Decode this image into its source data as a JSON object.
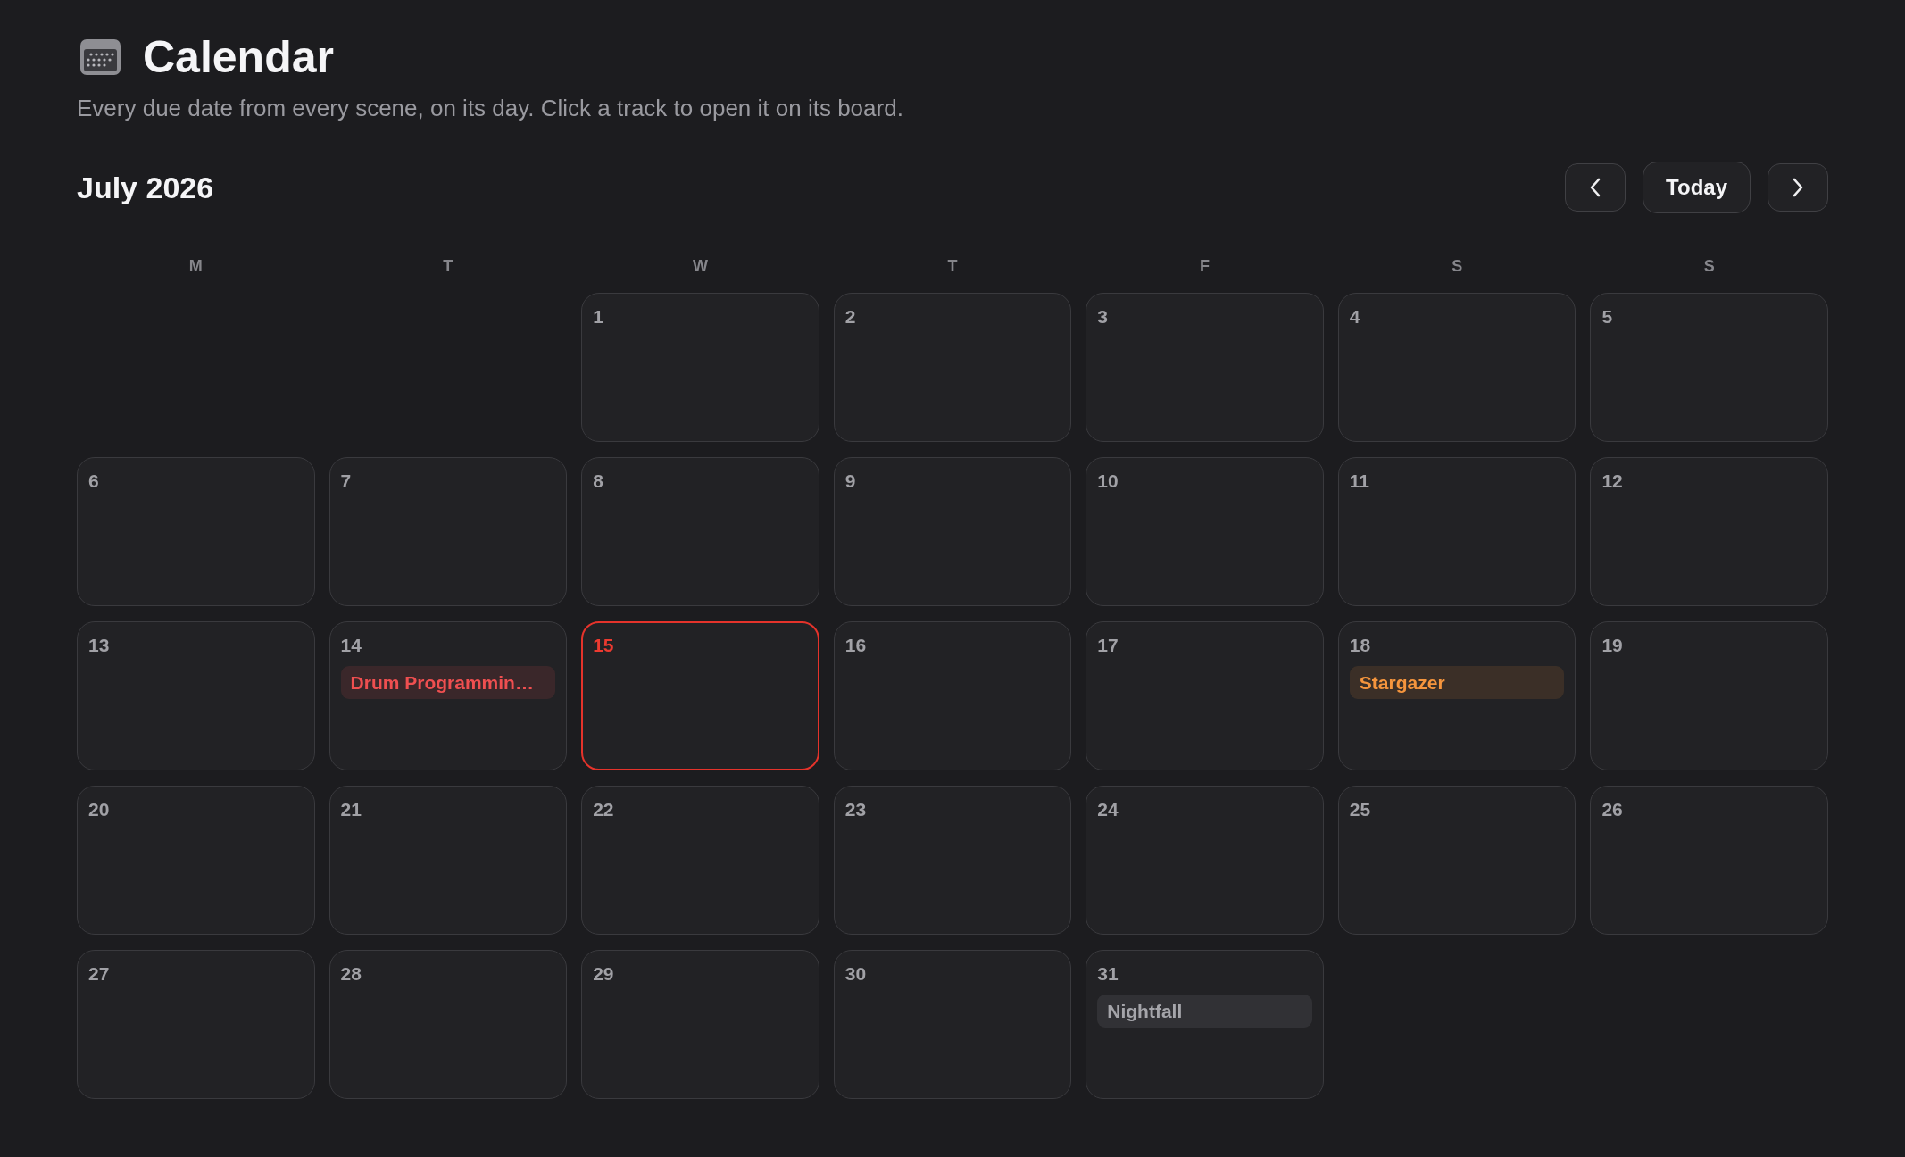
{
  "header": {
    "title": "Calendar",
    "subtitle": "Every due date from every scene, on its day. Click a track to open it on its board."
  },
  "month": {
    "label": "July 2026",
    "today_button": "Today"
  },
  "weekdays": [
    "M",
    "T",
    "W",
    "T",
    "F",
    "S",
    "S"
  ],
  "weeks": [
    {
      "days": [
        {
          "kind": "blank"
        },
        {
          "kind": "blank"
        },
        {
          "kind": "day",
          "number": "1",
          "today": false
        },
        {
          "kind": "day",
          "number": "2",
          "today": false
        },
        {
          "kind": "day",
          "number": "3",
          "today": false
        },
        {
          "kind": "day",
          "number": "4",
          "today": false
        },
        {
          "kind": "day",
          "number": "5",
          "today": false
        }
      ]
    },
    {
      "days": [
        {
          "kind": "day",
          "number": "6",
          "today": false
        },
        {
          "kind": "day",
          "number": "7",
          "today": false
        },
        {
          "kind": "day",
          "number": "8",
          "today": false
        },
        {
          "kind": "day",
          "number": "9",
          "today": false
        },
        {
          "kind": "day",
          "number": "10",
          "today": false
        },
        {
          "kind": "day",
          "number": "11",
          "today": false
        },
        {
          "kind": "day",
          "number": "12",
          "today": false
        }
      ]
    },
    {
      "days": [
        {
          "kind": "day",
          "number": "13",
          "today": false
        },
        {
          "kind": "day",
          "number": "14",
          "today": false,
          "events": [
            {
              "title": "Drum Programmin…",
              "color": "#ef4f50"
            }
          ]
        },
        {
          "kind": "day",
          "number": "15",
          "today": true
        },
        {
          "kind": "day",
          "number": "16",
          "today": false
        },
        {
          "kind": "day",
          "number": "17",
          "today": false
        },
        {
          "kind": "day",
          "number": "18",
          "today": false,
          "events": [
            {
              "title": "Stargazer",
              "color": "#f5953d"
            }
          ]
        },
        {
          "kind": "day",
          "number": "19",
          "today": false
        }
      ]
    },
    {
      "days": [
        {
          "kind": "day",
          "number": "20",
          "today": false
        },
        {
          "kind": "day",
          "number": "21",
          "today": false
        },
        {
          "kind": "day",
          "number": "22",
          "today": false
        },
        {
          "kind": "day",
          "number": "23",
          "today": false
        },
        {
          "kind": "day",
          "number": "24",
          "today": false
        },
        {
          "kind": "day",
          "number": "25",
          "today": false
        },
        {
          "kind": "day",
          "number": "26",
          "today": false
        }
      ]
    },
    {
      "days": [
        {
          "kind": "day",
          "number": "27",
          "today": false
        },
        {
          "kind": "day",
          "number": "28",
          "today": false
        },
        {
          "kind": "day",
          "number": "29",
          "today": false
        },
        {
          "kind": "day",
          "number": "30",
          "today": false
        },
        {
          "kind": "day",
          "number": "31",
          "today": false,
          "events": [
            {
              "title": "Nightfall",
              "color": "#a5a5aa"
            }
          ]
        }
      ]
    }
  ]
}
